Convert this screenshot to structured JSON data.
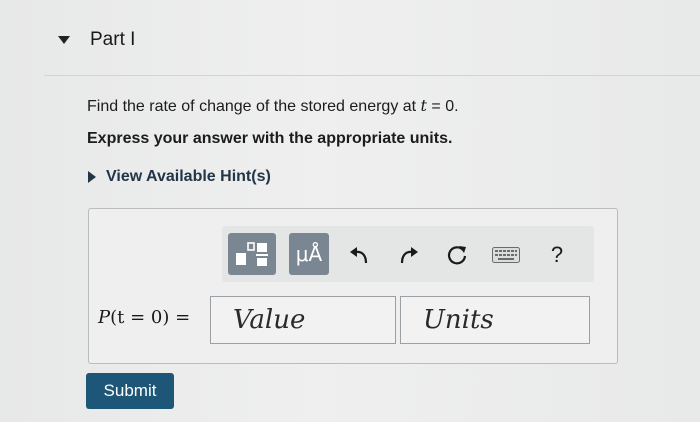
{
  "part": {
    "title": "Part I"
  },
  "question": {
    "prefix": "Find the rate of change of the stored energy at ",
    "var_t": "t",
    "suffix": " = 0."
  },
  "instruction": "Express your answer with the appropriate units.",
  "hint": {
    "label": "View Available Hint(s)"
  },
  "toolbar": {
    "symbol_button_label": "μÅ",
    "help_label": "?"
  },
  "answer": {
    "label_p": "P",
    "label_rest": "(t = 0) =",
    "value_placeholder": "Value",
    "units_placeholder": "Units"
  },
  "submit_label": "Submit",
  "colors": {
    "submit_bg": "#1d5676",
    "toolbar_button_bg": "#7b8693",
    "hint_text": "#223547"
  }
}
